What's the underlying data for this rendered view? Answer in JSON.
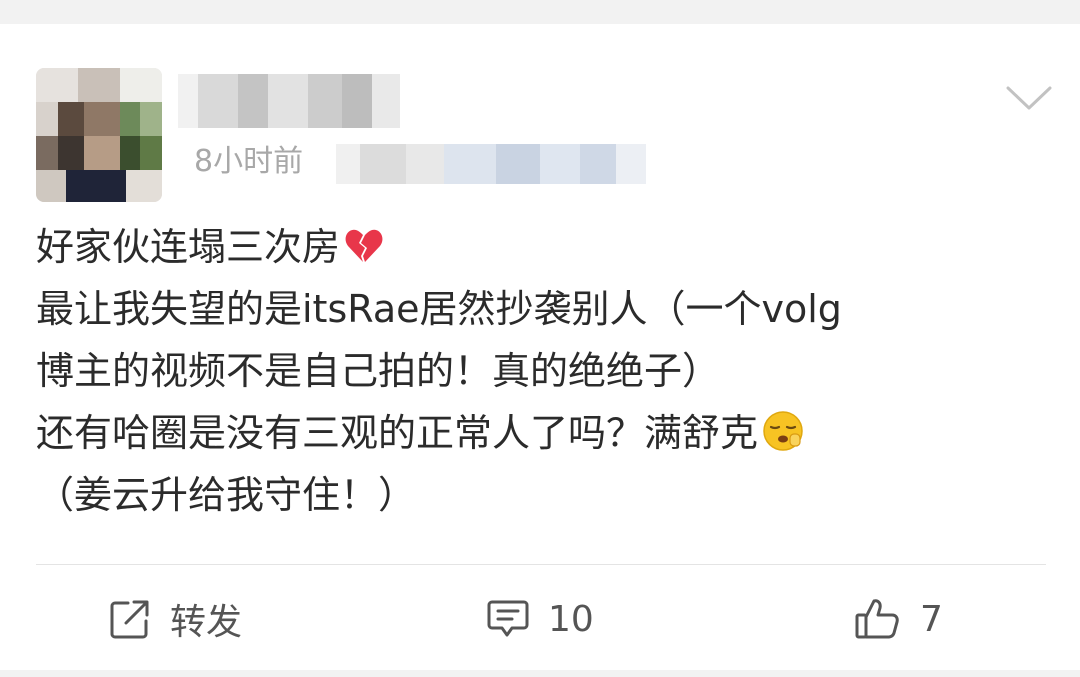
{
  "post": {
    "time": "8小时前",
    "content_lines": [
      "好家伙连塌三次房",
      "最让我失望的是itsRae居然抄袭别人（一个volg",
      "博主的视频不是自己拍的！真的绝绝子）",
      "还有哈圈是没有三观的正常人了吗？满舒克",
      "（姜云升给我守住！）"
    ],
    "emojis": {
      "line0": "broken-heart-emoji",
      "line3": "yawning-face-emoji"
    }
  },
  "actions": {
    "repost_label": "转发",
    "comment_count": "10",
    "like_count": "7"
  },
  "icons": {
    "menu": "chevron-down-icon",
    "repost": "share-square-icon",
    "comment": "comment-bubble-icon",
    "like": "thumbs-up-icon"
  },
  "colors": {
    "text": "#2b2b2b",
    "meta": "#a8a8a8",
    "action": "#555555",
    "heart": "#e8364a",
    "emoji_yellow": "#f7c323"
  }
}
